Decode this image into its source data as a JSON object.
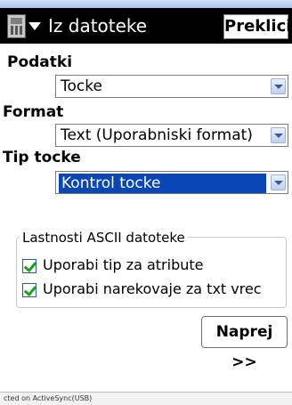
{
  "window": {
    "title": "Iz datoteke",
    "menu_icon": "handheld-device-icon",
    "cancel_label": "Preklici"
  },
  "form": {
    "data_label": "Podatki",
    "data_value": "Tocke",
    "format_label": "Format",
    "format_value": "Text (Uporabniski format)",
    "point_type_label": "Tip tocke",
    "point_type_value": "Kontrol tocke"
  },
  "ascii_group": {
    "title": "Lastnosti ASCII datoteke",
    "options": [
      {
        "label": "Uporabi tip za atribute",
        "checked": true
      },
      {
        "label": "Uporabi narekovaje za txt vrec",
        "checked": true
      }
    ]
  },
  "next_label": "Naprej >>",
  "status": {
    "text": "cted on ActiveSync(USB)"
  },
  "colors": {
    "titlebar": "#000000",
    "selection": "#0a46b5",
    "checkmark": "#18a018"
  }
}
